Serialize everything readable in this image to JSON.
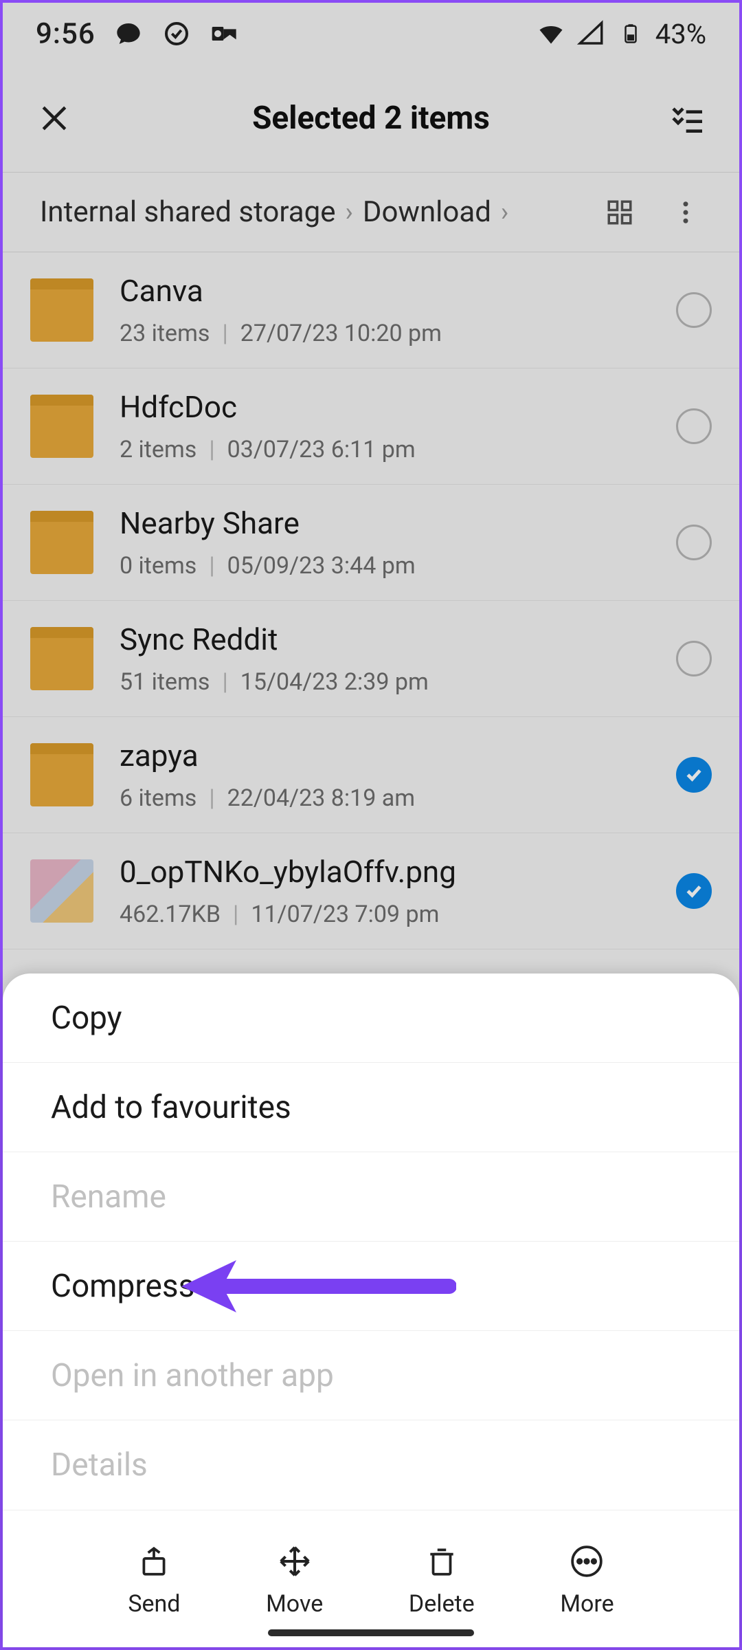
{
  "status": {
    "time": "9:56",
    "battery_text": "43%"
  },
  "header": {
    "title": "Selected 2 items"
  },
  "breadcrumb": {
    "root": "Internal shared storage",
    "current": "Download"
  },
  "files": [
    {
      "name": "Canva",
      "sub_left": "23 items",
      "sub_right": "27/07/23 10:20 pm",
      "type": "folder",
      "selected": false
    },
    {
      "name": "HdfcDoc",
      "sub_left": "2 items",
      "sub_right": "03/07/23 6:11 pm",
      "type": "folder",
      "selected": false
    },
    {
      "name": "Nearby Share",
      "sub_left": "0 items",
      "sub_right": "05/09/23 3:44 pm",
      "type": "folder",
      "selected": false
    },
    {
      "name": "Sync Reddit",
      "sub_left": "51 items",
      "sub_right": "15/04/23 2:39 pm",
      "type": "folder",
      "selected": false
    },
    {
      "name": "zapya",
      "sub_left": "6 items",
      "sub_right": "22/04/23 8:19 am",
      "type": "folder",
      "selected": true
    },
    {
      "name": "0_opTNKo_ybylaOffv.png",
      "sub_left": "462.17KB",
      "sub_right": "11/07/23 7:09 pm",
      "type": "image",
      "selected": true
    }
  ],
  "sheet": {
    "items": [
      {
        "label": "Copy",
        "enabled": true
      },
      {
        "label": "Add to favourites",
        "enabled": true
      },
      {
        "label": "Rename",
        "enabled": false
      },
      {
        "label": "Compress",
        "enabled": true
      },
      {
        "label": "Open in another app",
        "enabled": false
      },
      {
        "label": "Details",
        "enabled": false
      }
    ]
  },
  "actions": {
    "send": "Send",
    "move": "Move",
    "delete": "Delete",
    "more": "More"
  },
  "annotation_arrow_color": "#7a40f2"
}
